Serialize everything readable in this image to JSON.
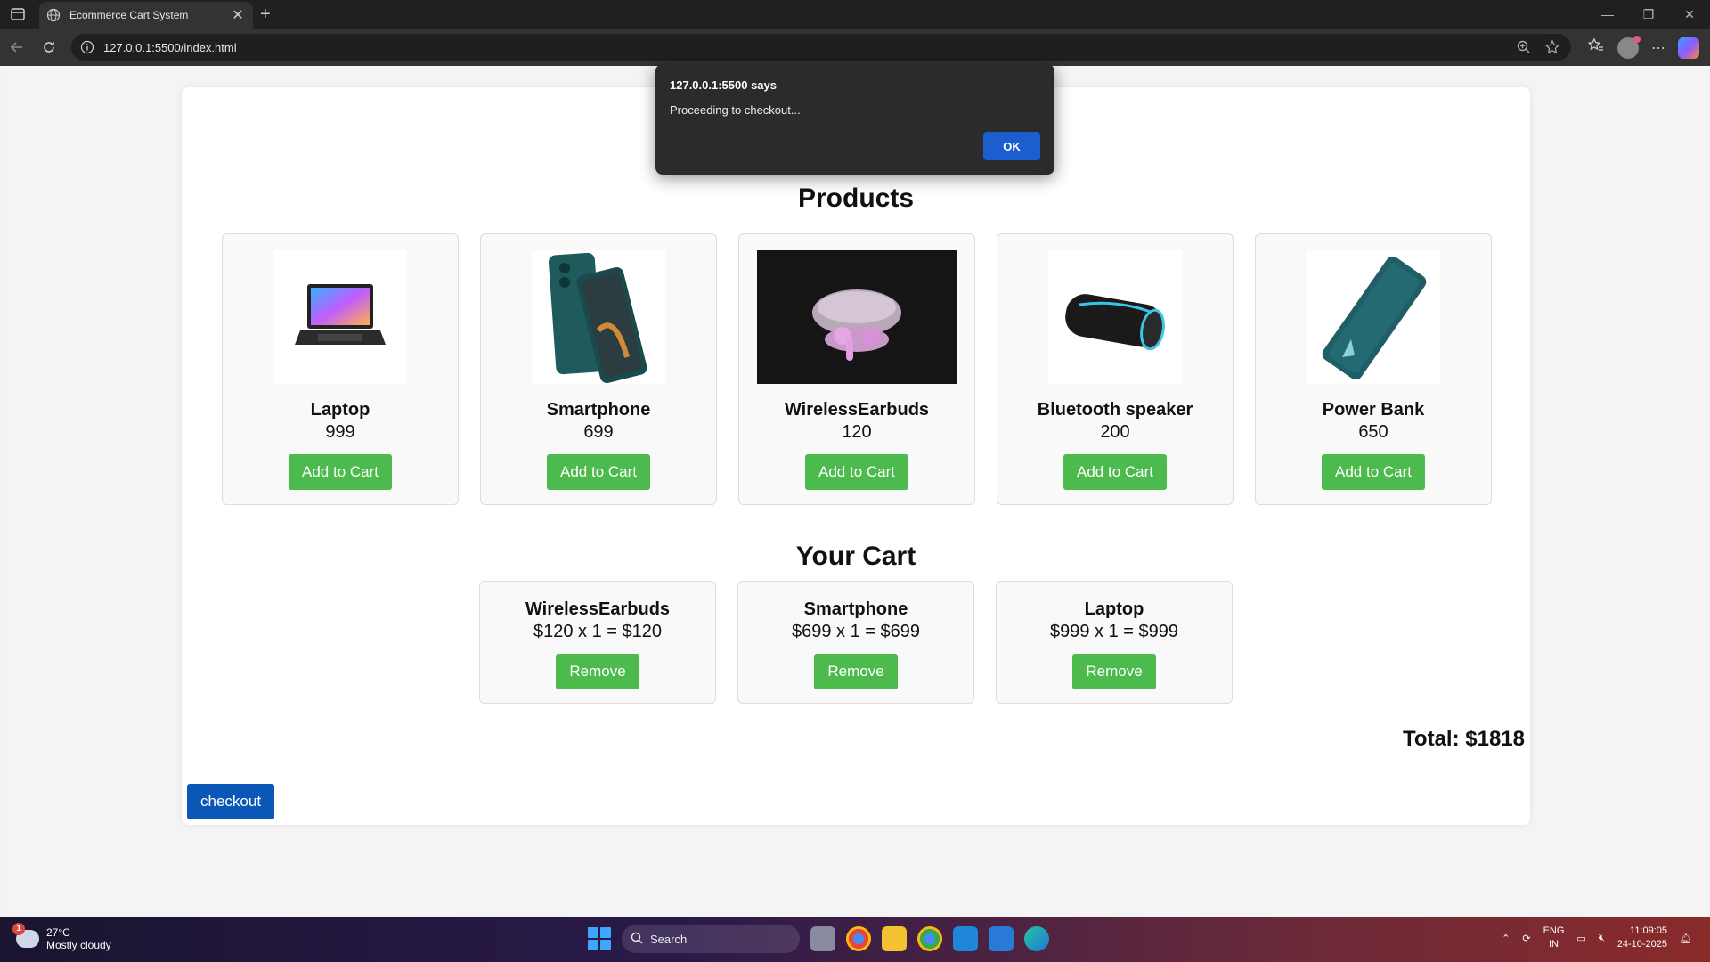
{
  "browser": {
    "tab_title": "Ecommerce Cart System",
    "url": "127.0.0.1:5500/index.html"
  },
  "alert": {
    "title": "127.0.0.1:5500 says",
    "message": "Proceeding to checkout...",
    "ok_label": "OK"
  },
  "page": {
    "products_heading": "Products",
    "cart_heading": "Your Cart",
    "total_label": "Total: $1818",
    "checkout_label": "checkout"
  },
  "products": [
    {
      "name": "Laptop",
      "price": "999",
      "button": "Add to Cart"
    },
    {
      "name": "Smartphone",
      "price": "699",
      "button": "Add to Cart"
    },
    {
      "name": "WirelessEarbuds",
      "price": "120",
      "button": "Add to Cart"
    },
    {
      "name": "Bluetooth speaker",
      "price": "200",
      "button": "Add to Cart"
    },
    {
      "name": "Power Bank",
      "price": "650",
      "button": "Add to Cart"
    }
  ],
  "cart": [
    {
      "name": "WirelessEarbuds",
      "line": "$120 x 1 = $120",
      "button": "Remove"
    },
    {
      "name": "Smartphone",
      "line": "$699 x 1 = $699",
      "button": "Remove"
    },
    {
      "name": "Laptop",
      "line": "$999 x 1 = $999",
      "button": "Remove"
    }
  ],
  "taskbar": {
    "weather_badge": "1",
    "temperature": "27°C",
    "condition": "Mostly cloudy",
    "search_label": "Search",
    "lang_line1": "ENG",
    "lang_line2": "IN",
    "time": "11:09:05",
    "date": "24-10-2025"
  },
  "colors": {
    "add_button": "#4cba4c",
    "checkout_button": "#0a57b8",
    "alert_ok": "#1c5ecf"
  }
}
